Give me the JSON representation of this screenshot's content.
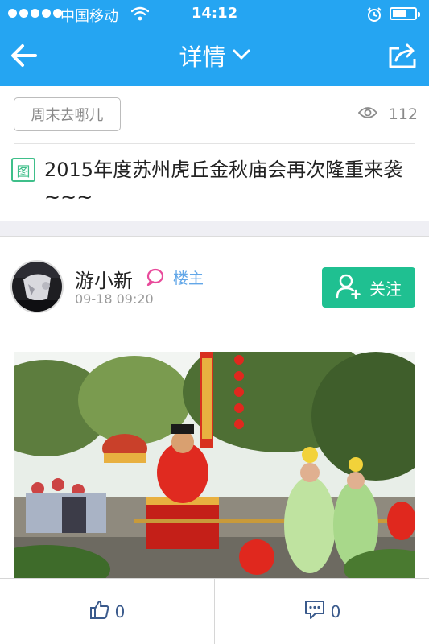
{
  "status_bar": {
    "carrier": "中国移动",
    "time": "14:12",
    "signal_icon": "signal-dots-icon",
    "wifi_icon": "wifi-icon",
    "alarm_icon": "alarm-clock-icon",
    "battery_level": 0.6
  },
  "nav": {
    "back_icon": "arrow-left-icon",
    "title": "详情",
    "title_dropdown_icon": "chevron-down-icon",
    "share_icon": "share-icon"
  },
  "topic": {
    "tag_label": "周末去哪儿",
    "view_icon": "eye-icon",
    "view_count": "112"
  },
  "post": {
    "image_badge": "图",
    "title": "2015年度苏州虎丘金秋庙会再次隆重来袭~~~"
  },
  "author": {
    "name": "游小新",
    "owner_icon": "chat-bubble-icon",
    "owner_label": "楼主",
    "time": "09-18 09:20",
    "follow_label": "关注",
    "follow_icon": "add-user-icon"
  },
  "photo": {
    "subject": "temple-fair-parade-photo"
  },
  "bottom_bar": {
    "like_icon": "thumbs-up-icon",
    "like_count": "0",
    "comment_icon": "comment-icon",
    "comment_count": "0"
  },
  "colors": {
    "primary": "#25a5f2",
    "follow_green": "#1fc091",
    "badge_green": "#3fbf8a",
    "owner_pink": "#e84a9b",
    "owner_blue": "#62a7e8"
  }
}
